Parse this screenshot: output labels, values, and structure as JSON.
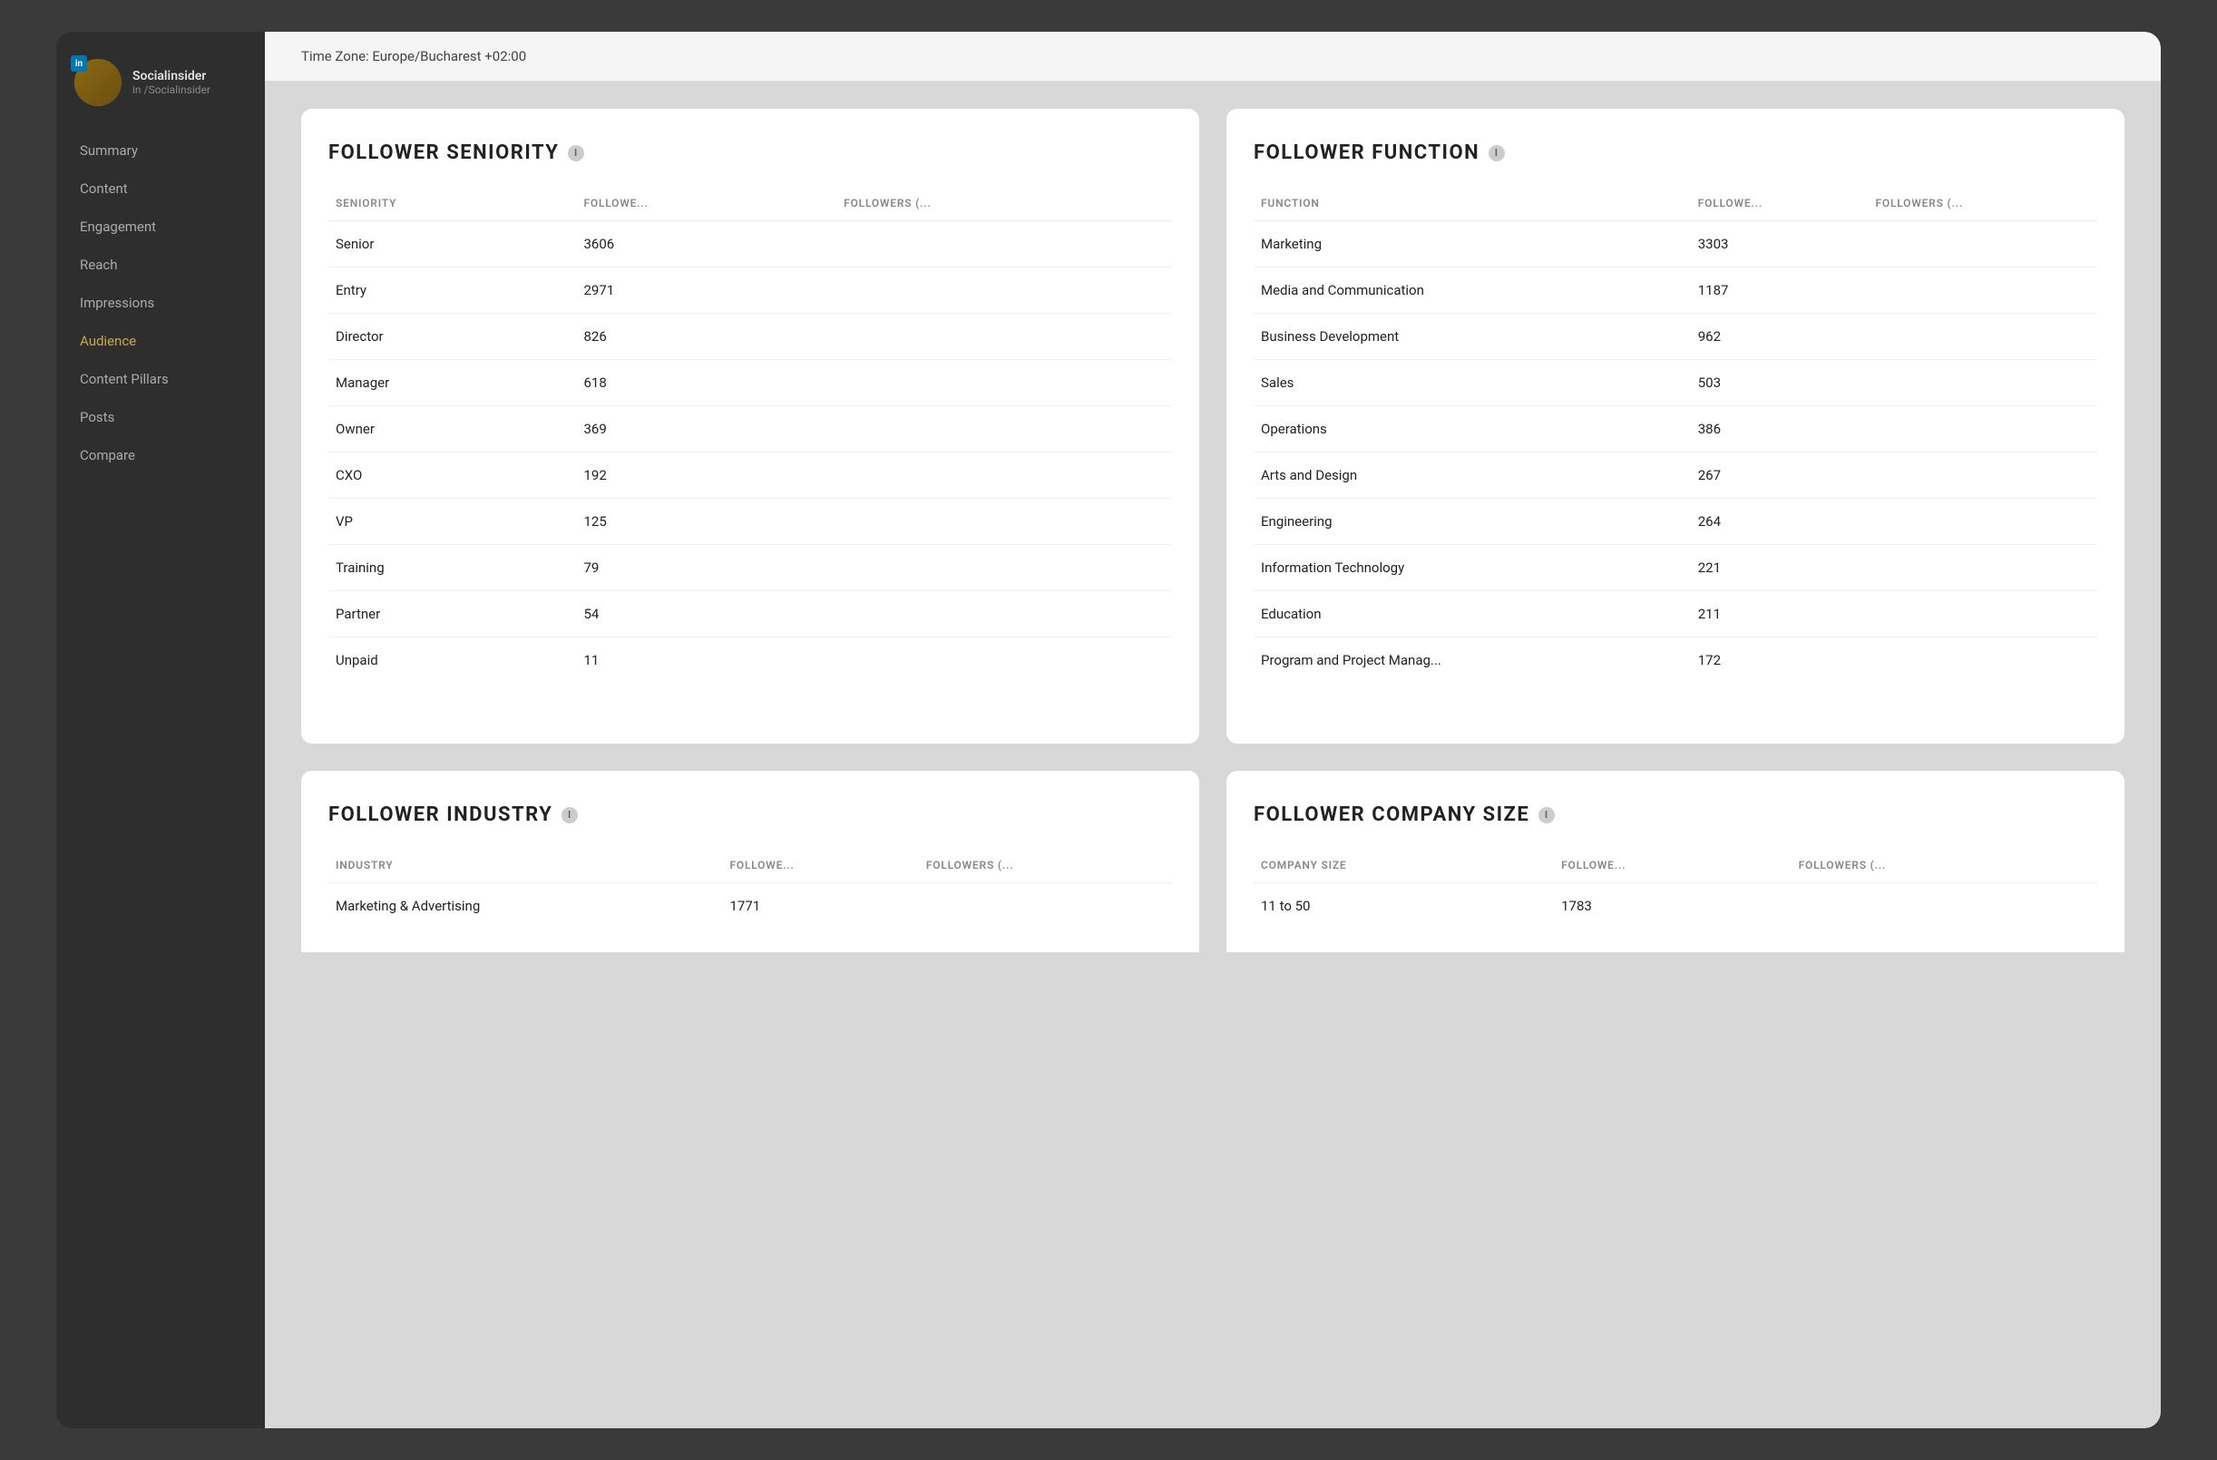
{
  "app": {
    "title": "Socialinsider"
  },
  "profile": {
    "name": "Socialinsider",
    "handle": "in /Socialinsider",
    "network": "in"
  },
  "sidebar": {
    "items": [
      {
        "id": "summary",
        "label": "Summary",
        "active": false
      },
      {
        "id": "content",
        "label": "Content",
        "active": false
      },
      {
        "id": "engagement",
        "label": "Engagement",
        "active": false
      },
      {
        "id": "reach",
        "label": "Reach",
        "active": false
      },
      {
        "id": "impressions",
        "label": "Impressions",
        "active": false
      },
      {
        "id": "audience",
        "label": "Audience",
        "active": true
      },
      {
        "id": "content-pillars",
        "label": "Content Pillars",
        "active": false
      },
      {
        "id": "posts",
        "label": "Posts",
        "active": false
      },
      {
        "id": "compare",
        "label": "Compare",
        "active": false
      }
    ]
  },
  "timezone": {
    "label": "Time Zone: Europe/Bucharest +02:00"
  },
  "follower_seniority": {
    "title": "FOLLOWER SENIORITY",
    "columns": [
      "SENIORITY",
      "FOLLOWE...",
      "FOLLOWERS (..."
    ],
    "rows": [
      {
        "label": "Senior",
        "count": "3606",
        "pct": ""
      },
      {
        "label": "Entry",
        "count": "2971",
        "pct": ""
      },
      {
        "label": "Director",
        "count": "826",
        "pct": ""
      },
      {
        "label": "Manager",
        "count": "618",
        "pct": ""
      },
      {
        "label": "Owner",
        "count": "369",
        "pct": ""
      },
      {
        "label": "CXO",
        "count": "192",
        "pct": ""
      },
      {
        "label": "VP",
        "count": "125",
        "pct": ""
      },
      {
        "label": "Training",
        "count": "79",
        "pct": ""
      },
      {
        "label": "Partner",
        "count": "54",
        "pct": ""
      },
      {
        "label": "Unpaid",
        "count": "11",
        "pct": ""
      }
    ]
  },
  "follower_function": {
    "title": "FOLLOWER FUNCTION",
    "columns": [
      "FUNCTION",
      "FOLLOWE...",
      "FOLLOWERS (..."
    ],
    "rows": [
      {
        "label": "Marketing",
        "count": "3303",
        "pct": ""
      },
      {
        "label": "Media and Communication",
        "count": "1187",
        "pct": ""
      },
      {
        "label": "Business Development",
        "count": "962",
        "pct": ""
      },
      {
        "label": "Sales",
        "count": "503",
        "pct": ""
      },
      {
        "label": "Operations",
        "count": "386",
        "pct": ""
      },
      {
        "label": "Arts and Design",
        "count": "267",
        "pct": ""
      },
      {
        "label": "Engineering",
        "count": "264",
        "pct": ""
      },
      {
        "label": "Information Technology",
        "count": "221",
        "pct": ""
      },
      {
        "label": "Education",
        "count": "211",
        "pct": ""
      },
      {
        "label": "Program and Project Manag...",
        "count": "172",
        "pct": ""
      }
    ]
  },
  "follower_industry": {
    "title": "FOLLOWER INDUSTRY",
    "columns": [
      "INDUSTRY",
      "FOLLOWE...",
      "FOLLOWERS (..."
    ],
    "rows": [
      {
        "label": "Marketing & Advertising",
        "count": "1771",
        "pct": ""
      }
    ]
  },
  "follower_company_size": {
    "title": "FOLLOWER COMPANY SIZE",
    "columns": [
      "COMPANY SIZE",
      "FOLLOWE...",
      "FOLLOWERS (..."
    ],
    "rows": [
      {
        "label": "11 to 50",
        "count": "1783",
        "pct": ""
      }
    ]
  }
}
